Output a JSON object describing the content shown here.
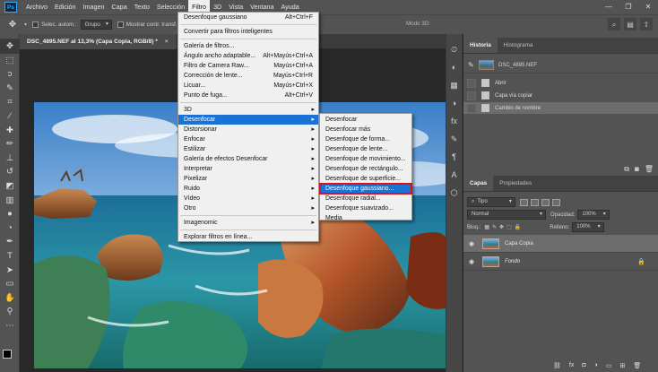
{
  "app": {
    "logo": "Ps"
  },
  "menubar": {
    "items": [
      "Archivo",
      "Edición",
      "Imagen",
      "Capa",
      "Texto",
      "Selección",
      "Filtro",
      "3D",
      "Vista",
      "Ventana",
      "Ayuda"
    ],
    "active_index": 6,
    "window_controls": [
      "—",
      "❐",
      "✕"
    ]
  },
  "options": {
    "auto_select_label": "Selec. autom.:",
    "auto_select_value": "Grupo",
    "show_transform_label": "Mostrar contr. transf.",
    "mode_3d": "Modo 3D:"
  },
  "document": {
    "tab_title": "DSC_4895.NEF al 13,3% (Capa Copia, RGB/8) *"
  },
  "filter_menu": {
    "items": [
      {
        "label": "Desenfoque gaussiano",
        "shortcut": "Alt+Ctrl+F"
      },
      {
        "sep": true
      },
      {
        "label": "Convertir para filtros inteligentes"
      },
      {
        "sep": true
      },
      {
        "label": "Galería de filtros..."
      },
      {
        "label": "Ángulo ancho adaptable...",
        "shortcut": "Alt+Mayús+Ctrl+A"
      },
      {
        "label": "Filtro de Camera Raw...",
        "shortcut": "Mayús+Ctrl+A"
      },
      {
        "label": "Corrección de lente...",
        "shortcut": "Mayús+Ctrl+R"
      },
      {
        "label": "Licuar...",
        "shortcut": "Mayús+Ctrl+X"
      },
      {
        "label": "Punto de fuga...",
        "shortcut": "Alt+Ctrl+V"
      },
      {
        "sep": true
      },
      {
        "label": "3D",
        "submenu": true
      },
      {
        "label": "Desenfocar",
        "submenu": true,
        "highlighted": true
      },
      {
        "label": "Distorsionar",
        "submenu": true
      },
      {
        "label": "Enfocar",
        "submenu": true
      },
      {
        "label": "Estilizar",
        "submenu": true
      },
      {
        "label": "Galería de efectos Desenfocar",
        "submenu": true
      },
      {
        "label": "Interpretar",
        "submenu": true
      },
      {
        "label": "Pixelizar",
        "submenu": true
      },
      {
        "label": "Ruido",
        "submenu": true
      },
      {
        "label": "Vídeo",
        "submenu": true
      },
      {
        "label": "Otro",
        "submenu": true
      },
      {
        "sep": true
      },
      {
        "label": "Imagenomic",
        "submenu": true
      },
      {
        "sep": true
      },
      {
        "label": "Explorar filtros en línea..."
      }
    ]
  },
  "blur_submenu": {
    "items": [
      {
        "label": "Desenfocar"
      },
      {
        "label": "Desenfocar más"
      },
      {
        "label": "Desenfoque de forma..."
      },
      {
        "label": "Desenfoque de lente..."
      },
      {
        "label": "Desenfoque de movimiento..."
      },
      {
        "label": "Desenfoque de rectángulo..."
      },
      {
        "label": "Desenfoque de superficie..."
      },
      {
        "label": "Desenfoque gaussiano...",
        "highlighted": true,
        "boxed": true
      },
      {
        "label": "Desenfoque radial..."
      },
      {
        "label": "Desenfoque suavizado..."
      },
      {
        "label": "Media"
      }
    ]
  },
  "history_panel": {
    "tabs": [
      "Historia",
      "Histograma"
    ],
    "snapshot": "DSC_4895.NEF",
    "steps": [
      "Abrir",
      "Capa vía copiar",
      "Cambio de nombre"
    ],
    "current_step": 2
  },
  "layers_panel": {
    "tabs": [
      "Capas",
      "Propiedades"
    ],
    "filter_kind": "Tipo",
    "blend_mode": "Normal",
    "opacity_label": "Opacidad:",
    "opacity_value": "100%",
    "lock_label": "Bloq.:",
    "fill_label": "Relleno:",
    "fill_value": "100%",
    "layers": [
      {
        "name": "Capa Copia",
        "selected": true
      },
      {
        "name": "Fondo",
        "locked": true
      }
    ]
  }
}
